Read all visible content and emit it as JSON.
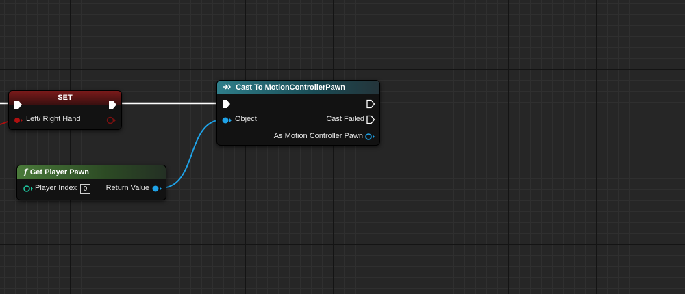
{
  "nodes": {
    "set": {
      "title": "SET",
      "input_label": "Left/ Right Hand"
    },
    "cast": {
      "icon": "cast-arrow-icon",
      "title": "Cast To MotionControllerPawn",
      "object_label": "Object",
      "cast_failed_label": "Cast Failed",
      "output_label": "As Motion Controller Pawn"
    },
    "get_player_pawn": {
      "icon": "function-icon",
      "title": "Get Player Pawn",
      "player_index_label": "Player Index",
      "player_index_value": "0",
      "return_value_label": "Return Value"
    }
  },
  "colors": {
    "exec_wire": "#ffffff",
    "object_pin": "#1fa3e8",
    "enum_pin": "#b01010",
    "int_pin": "#1fc7a0",
    "set_header": "#7a1a1a",
    "cast_header": "#2f7e8a",
    "function_header": "#4a7a3a"
  }
}
